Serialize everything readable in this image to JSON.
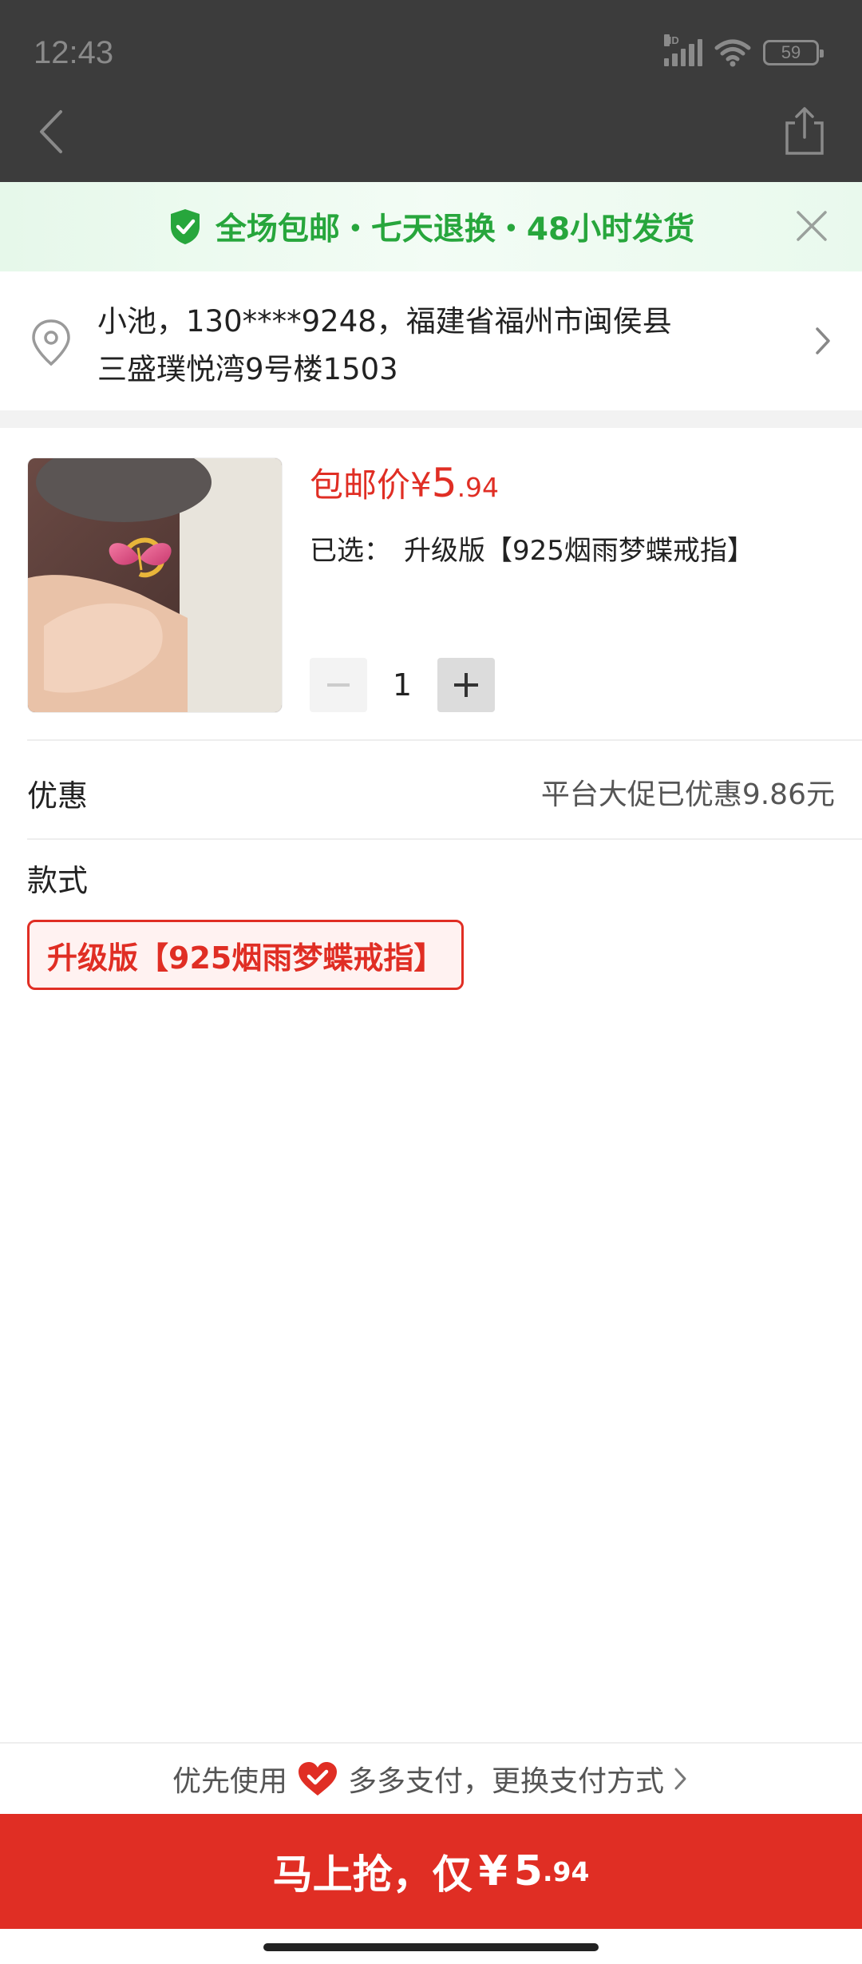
{
  "status_bar": {
    "time": "12:43",
    "hd": "HD",
    "battery": "59",
    "icons": [
      "signal-icon",
      "wifi-icon",
      "battery-icon"
    ]
  },
  "nav": {
    "back_icon": "back-chevron-icon",
    "share_icon": "share-icon"
  },
  "banner": {
    "text": "全场包邮・七天退换・48小时发货",
    "icon": "shield-check-icon",
    "close_icon": "close-icon",
    "color": "#27a63c"
  },
  "address": {
    "line1": "小池，130****9248，福建省福州市闽侯县",
    "line2": "三盛璞悦湾9号楼1503",
    "icon": "location-pin-icon",
    "arrow_icon": "chevron-right-icon"
  },
  "product": {
    "price_label": "包邮价",
    "currency": "¥",
    "price_int": "5",
    "price_dec": ".94",
    "selected_label": "已选：",
    "selected_value": "升级版【925烟雨梦蝶戒指】",
    "quantity": "1",
    "minus_label": "−",
    "plus_label": "+"
  },
  "discount": {
    "label": "优惠",
    "value": "平台大促已优惠9.86元"
  },
  "style": {
    "label": "款式",
    "option": "升级版【925烟雨梦蝶戒指】"
  },
  "payment": {
    "prefix": "优先使用",
    "method": "多多支付，更换支付方式",
    "icon": "heart-pay-icon"
  },
  "buy_button": {
    "label": "马上抢，仅",
    "currency": "¥",
    "amount_int": "5",
    "amount_dec": ".94"
  },
  "colors": {
    "accent": "#e02e24",
    "green": "#27a63c"
  }
}
